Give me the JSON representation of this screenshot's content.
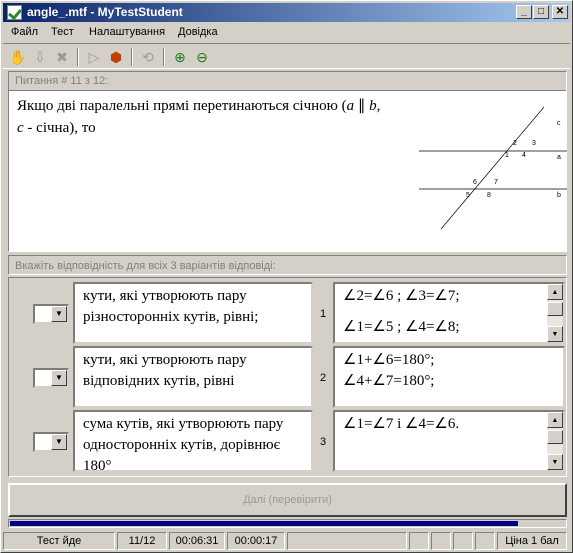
{
  "window": {
    "title": "angle_.mtf - MyTestStudent",
    "min_glyph": "_",
    "max_glyph": "□",
    "close_glyph": "✕"
  },
  "menu": [
    "Файл",
    "Тест",
    "Налаштування",
    "Довідка"
  ],
  "toolbar_icons": [
    "hand-icon",
    "down-arrow-icon",
    "close-x-icon",
    "play-icon",
    "stop-icon",
    "refresh-icon",
    "zoom-in-icon",
    "zoom-out-icon"
  ],
  "question": {
    "header": "Питання # 11 з 12:",
    "text_before": "Якщо дві паралельні прямі перетинаються січною (",
    "var_a": "a",
    "parallel": " ∥ ",
    "var_b": "b",
    "comma": ",",
    "var_c": "c",
    "text_after": " - січна), то",
    "diagram": {
      "labels": [
        "1",
        "2",
        "3",
        "4",
        "5",
        "6",
        "7",
        "8"
      ],
      "line_a": "a",
      "line_b": "b",
      "line_c": "c"
    }
  },
  "instruction": "Вкажіть відповідність для всіх 3 варіантів відповіді:",
  "rows": [
    {
      "combo_value": "",
      "left": "кути, які утворюють пару різносторонніх кутів, рівні;",
      "num": "1",
      "right": [
        "∠2=∠6 ; ∠3=∠7;",
        "",
        "∠1=∠5 ; ∠4=∠8;"
      ],
      "scroll": true
    },
    {
      "combo_value": "",
      "left": "кути, які утворюють пару відповідних кутів, рівні",
      "num": "2",
      "right": [
        "∠1+∠6=180°;",
        "∠4+∠7=180°;"
      ],
      "scroll": false
    },
    {
      "combo_value": "",
      "left": "сума кутів, які утворюють пару односторонніх кутів, дорівнює 180°",
      "num": "3",
      "right": [
        "∠1=∠7 і ∠4=∠6."
      ],
      "scroll": true
    }
  ],
  "next_button": "Далі (перевірити)",
  "progress": {
    "fraction": 0.915,
    "color": "#000080"
  },
  "status": {
    "state": "Тест йде",
    "question_counter": "11/12",
    "elapsed": "00:06:31",
    "question_time": "00:00:17",
    "score": "Ціна 1 бал"
  }
}
